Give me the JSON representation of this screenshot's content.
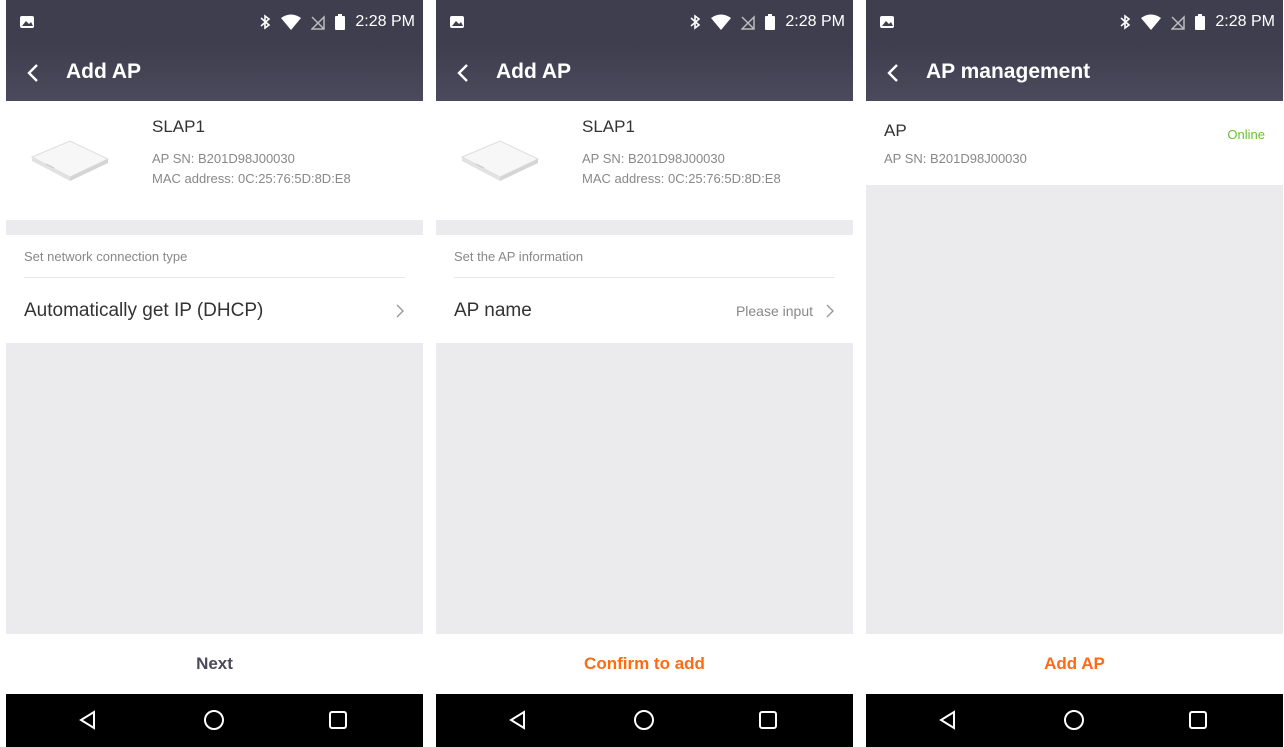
{
  "status_bar": {
    "time": "2:28 PM"
  },
  "screens": [
    {
      "title": "Add AP",
      "device": {
        "name": "SLAP1",
        "sn": "AP SN: B201D98J00030",
        "mac": "MAC address: 0C:25:76:5D:8D:E8"
      },
      "section_label": "Set network connection type",
      "row_label": "Automatically get IP (DHCP)",
      "row_value": "",
      "action": "Next"
    },
    {
      "title": "Add AP",
      "device": {
        "name": "SLAP1",
        "sn": "AP SN: B201D98J00030",
        "mac": "MAC address: 0C:25:76:5D:8D:E8"
      },
      "section_label": "Set the AP information",
      "row_label": "AP name",
      "row_value": "Please input",
      "action": "Confirm to add"
    },
    {
      "title": "AP management",
      "ap": {
        "name": "AP",
        "sn": "AP SN: B201D98J00030",
        "status": "Online"
      },
      "action": "Add AP"
    }
  ],
  "icons": {
    "back": "chevron-left-icon",
    "row_arrow": "chevron-right-icon",
    "status": [
      "image-icon",
      "bluetooth-icon",
      "wifi-icon",
      "no-sim-icon",
      "battery-icon"
    ],
    "nav": [
      "nav-back-icon",
      "nav-home-icon",
      "nav-recents-icon"
    ]
  },
  "colors": {
    "header": "#3e3e4f",
    "accent": "#ff6a13",
    "online": "#67c23a",
    "next_label": "#4a4a5c"
  }
}
